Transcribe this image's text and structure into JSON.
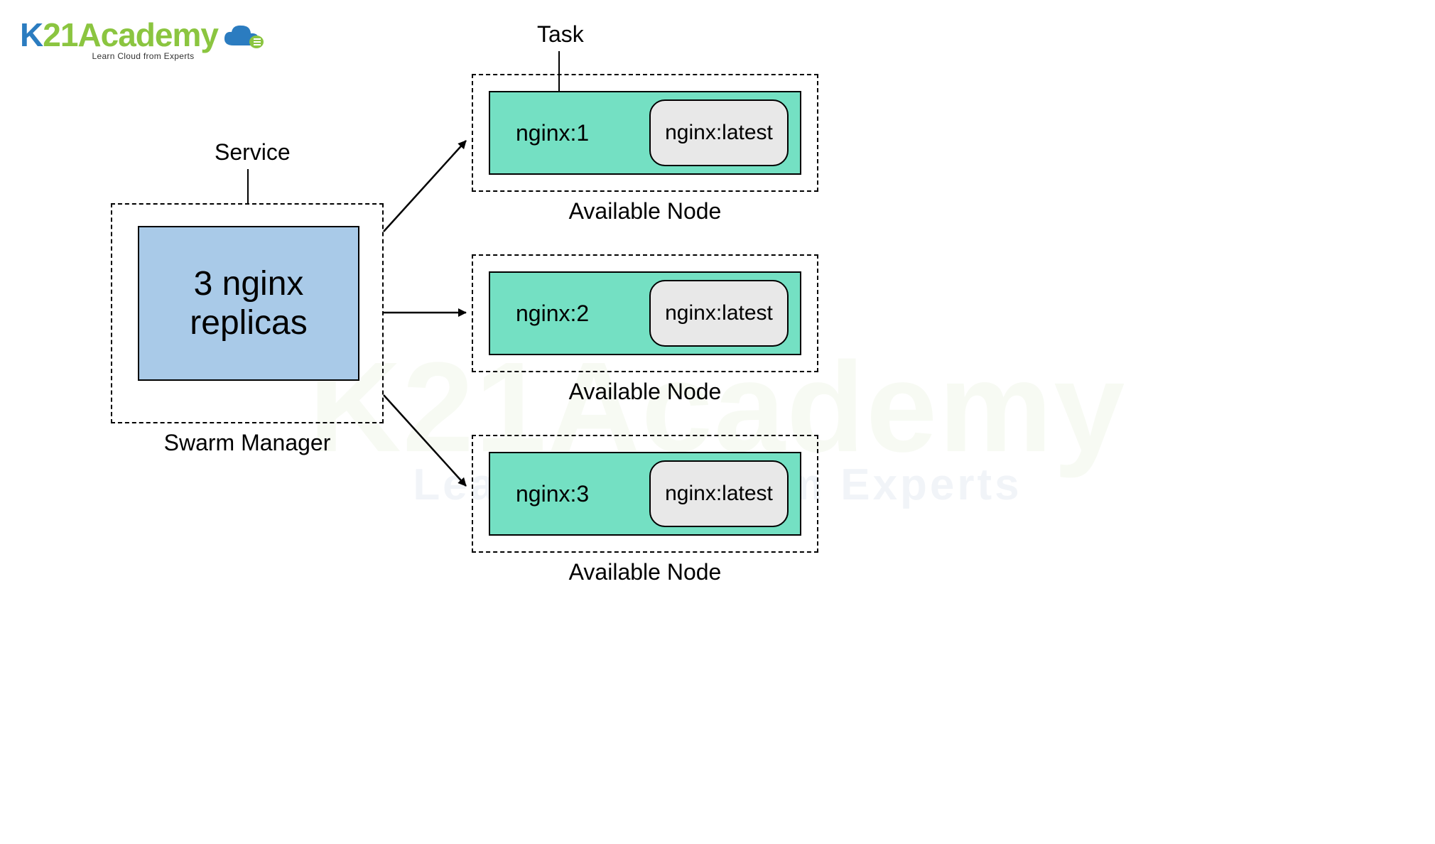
{
  "branding": {
    "logo_prefix": "K",
    "logo_num": "21",
    "logo_suffix": "Academy",
    "tagline": "Learn Cloud from Experts"
  },
  "labels": {
    "service": "Service",
    "task": "Task",
    "swarm_manager": "Swarm Manager",
    "available_node": "Available Node"
  },
  "service": {
    "text_line1": "3 nginx",
    "text_line2": "replicas"
  },
  "nodes": [
    {
      "task": "nginx:1",
      "image": "nginx:latest"
    },
    {
      "task": "nginx:2",
      "image": "nginx:latest"
    },
    {
      "task": "nginx:3",
      "image": "nginx:latest"
    }
  ],
  "watermark": {
    "main": "K21Academy",
    "sub": "Learn Cloud from Experts"
  }
}
